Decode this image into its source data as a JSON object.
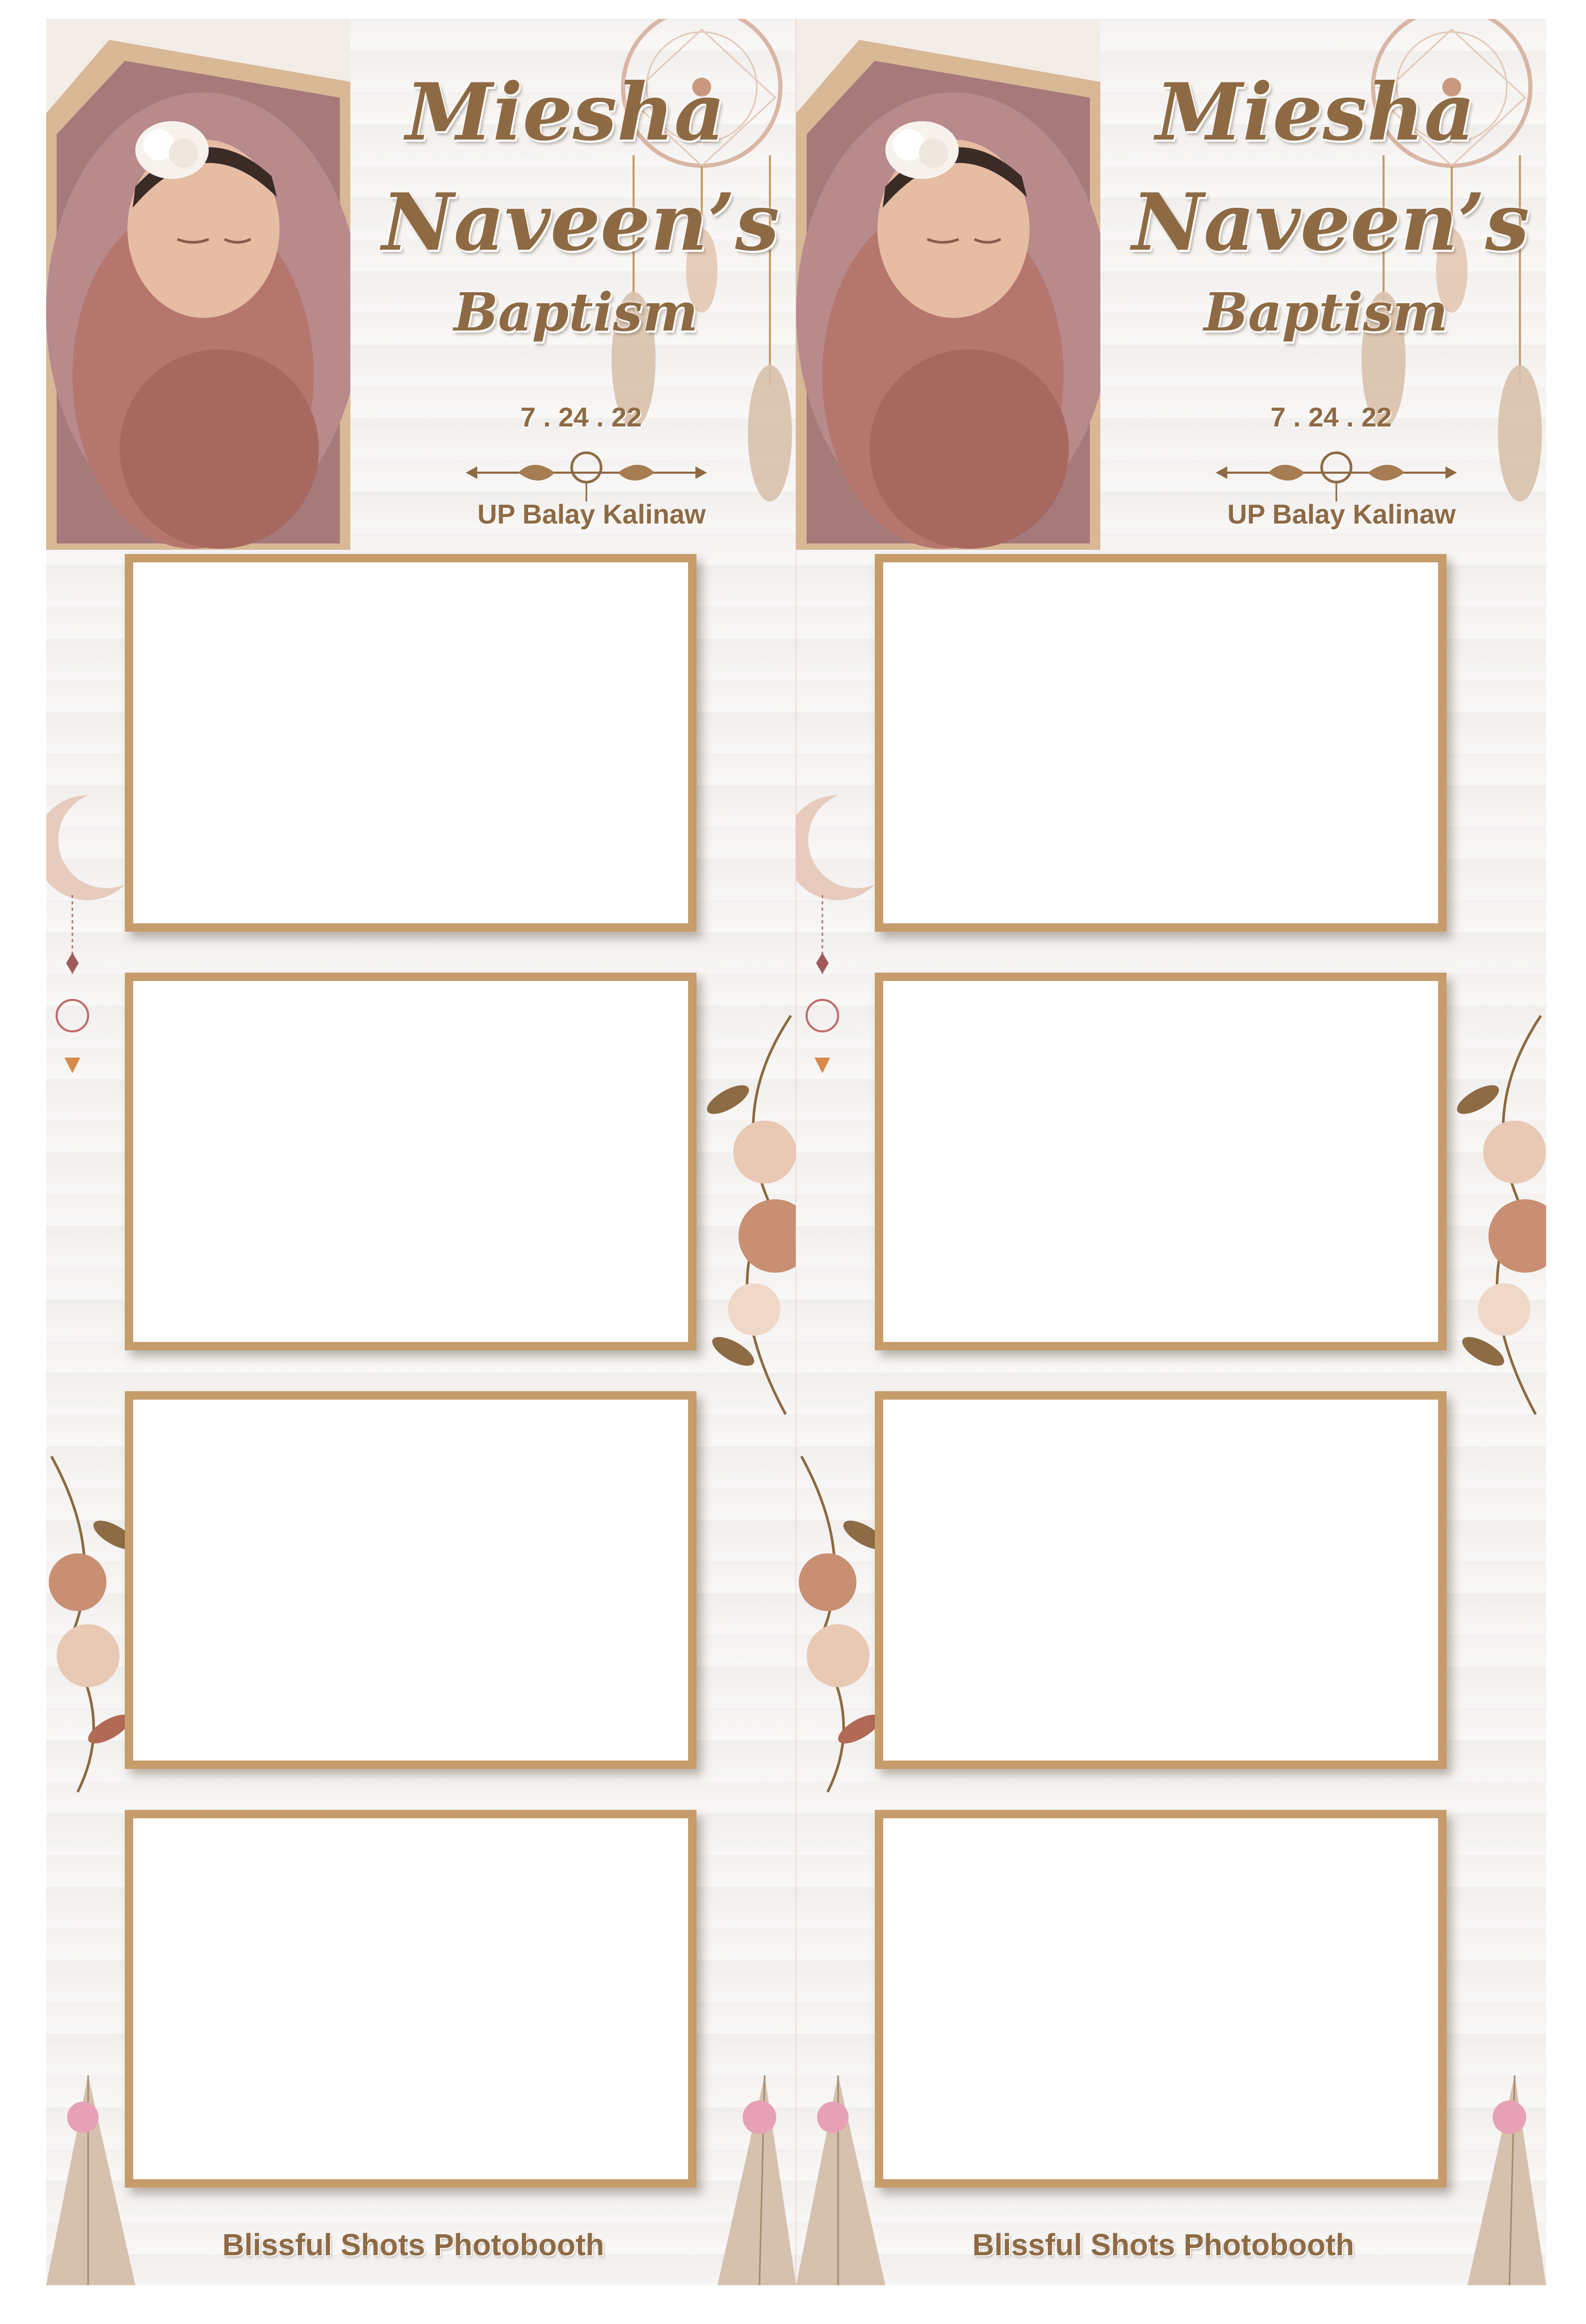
{
  "event": {
    "name_line1": "Miesha",
    "name_line2": "Naveen’s",
    "occasion": "Baptism",
    "date": "7 . 24 . 22",
    "venue": "UP Balay Kalinaw"
  },
  "footer": {
    "brand": "Blissful Shots Photobooth"
  },
  "strips": [
    {
      "photo_frames": [
        {
          "state": "empty"
        },
        {
          "state": "empty"
        },
        {
          "state": "empty"
        },
        {
          "state": "empty"
        }
      ]
    },
    {
      "photo_frames": [
        {
          "state": "empty"
        },
        {
          "state": "empty"
        },
        {
          "state": "empty"
        },
        {
          "state": "empty"
        }
      ]
    }
  ],
  "colors": {
    "text_brown": "#8e6a44",
    "frame_border": "#c69c6b",
    "background": "#f6f5f3",
    "blanket_pink": "#b5776d",
    "cut_line": "#f1b9c3"
  },
  "icons": [
    "dreamcatcher-icon",
    "arrow-divider-icon",
    "crescent-moon-icon",
    "flower-icon",
    "teepee-icon",
    "feather-icon"
  ]
}
